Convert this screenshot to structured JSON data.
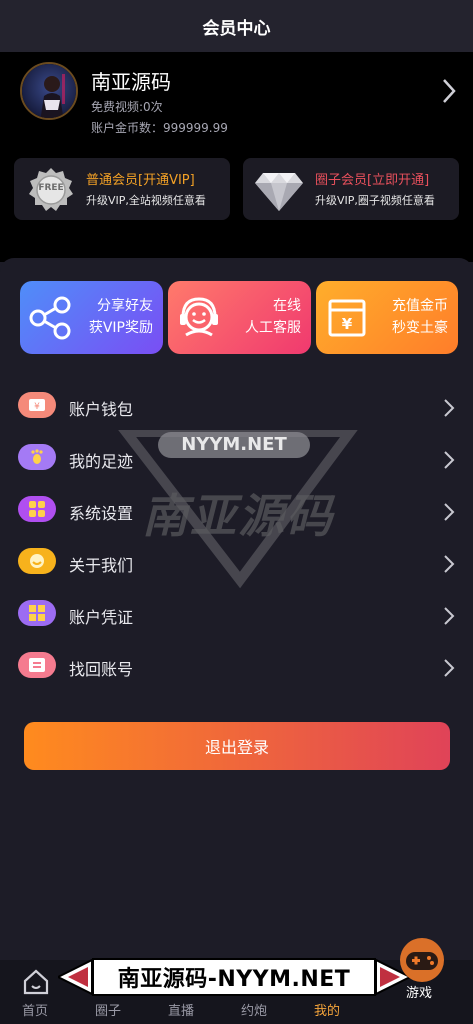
{
  "header": {
    "title": "会员中心"
  },
  "user": {
    "name": "南亚源码",
    "free_videos": "免费视频:0次",
    "coins": "账户金币数：999999.99"
  },
  "vip_cards": [
    {
      "title": "普通会员[开通VIP]",
      "desc": "升级VIP,全站视频任意看",
      "badge_text": "FREE"
    },
    {
      "title": "圈子会员[立即开通]",
      "desc": "升级VIP,圈子视频任意看"
    }
  ],
  "features": [
    {
      "line1": "分享好友",
      "line2": "获VIP奖励"
    },
    {
      "line1": "在线",
      "line2": "人工客服"
    },
    {
      "line1": "充值金币",
      "line2": "秒变土豪"
    }
  ],
  "menu": [
    {
      "label": "账户钱包",
      "color": "#f58a7a"
    },
    {
      "label": "我的足迹",
      "color": "#a47af5"
    },
    {
      "label": "系统设置",
      "color": "#b04ff0"
    },
    {
      "label": "关于我们",
      "color": "#f7b21c"
    },
    {
      "label": "账户凭证",
      "color": "#9c6cf2"
    },
    {
      "label": "找回账号",
      "color": "#f57b8f"
    }
  ],
  "logout_label": "退出登录",
  "watermark": {
    "top": "NYYM.NET",
    "main": "南亚源码"
  },
  "tabs": [
    "首页",
    "圈子",
    "直播",
    "约炮",
    "我的"
  ],
  "banner_text": "南亚源码-NYYM.NET",
  "game_label": "游戏",
  "colors": {
    "accent": "#f4a43b",
    "gold": "#f3a126",
    "red": "#e8505c"
  }
}
